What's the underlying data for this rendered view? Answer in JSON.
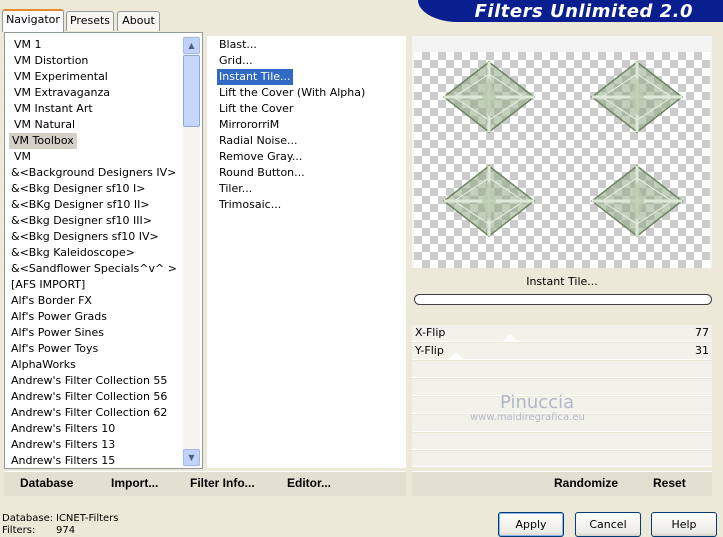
{
  "tabs": [
    {
      "label": "Navigator",
      "active": true
    },
    {
      "label": "Presets",
      "active": false
    },
    {
      "label": "About",
      "active": false
    }
  ],
  "title": "Filters Unlimited 2.0",
  "categories": [
    "VM 1",
    "VM Distortion",
    "VM Experimental",
    "VM Extravaganza",
    "VM Instant Art",
    "VM Natural",
    "VM Toolbox",
    "VM",
    "&<Background Designers IV>",
    "&<Bkg Designer sf10 I>",
    "&<BKg Designer sf10 II>",
    "&<Bkg Designer sf10 III>",
    "&<Bkg Designers sf10 IV>",
    "&<Bkg Kaleidoscope>",
    "&<Sandflower Specials^v^ >",
    "[AFS IMPORT]",
    "Alf's Border FX",
    "Alf's Power Grads",
    "Alf's Power Sines",
    "Alf's Power Toys",
    "AlphaWorks",
    "Andrew's Filter Collection 55",
    "Andrew's Filter Collection 56",
    "Andrew's Filter Collection 62",
    "Andrew's Filters 10",
    "Andrew's Filters 13",
    "Andrew's Filters 15"
  ],
  "selected_category": "VM Toolbox",
  "filters": [
    "Blast...",
    "Grid...",
    "Instant Tile...",
    "Lift the Cover (With Alpha)",
    "Lift the Cover",
    "MirrororriM",
    "Radial Noise...",
    "Remove Gray...",
    "Round Button...",
    "Tiler...",
    "Trimosaic..."
  ],
  "selected_filter": "Instant Tile...",
  "preview": {
    "filter_name": "Instant Tile...",
    "progress": 0
  },
  "params": [
    {
      "label": "X-Flip",
      "value": "77",
      "fraction": 0.3
    },
    {
      "label": "Y-Flip",
      "value": "31",
      "fraction": 0.12
    }
  ],
  "watermark": {
    "line1": "Pinuccia",
    "line2": "www.maidiregrafica.eu"
  },
  "toolbar": {
    "database": "Database",
    "import": "Import...",
    "filter_info": "Filter Info...",
    "editor": "Editor...",
    "randomize": "Randomize",
    "reset": "Reset"
  },
  "status": {
    "database_label": "Database:",
    "database_value": "ICNET-Filters",
    "filters_label": "Filters:",
    "filters_value": "974"
  },
  "buttons": {
    "apply": "Apply",
    "cancel": "Cancel",
    "help": "Help"
  },
  "colors": {
    "accent": "#316ac5",
    "banner": "#0a1f8f",
    "tile": "#8fa883"
  }
}
